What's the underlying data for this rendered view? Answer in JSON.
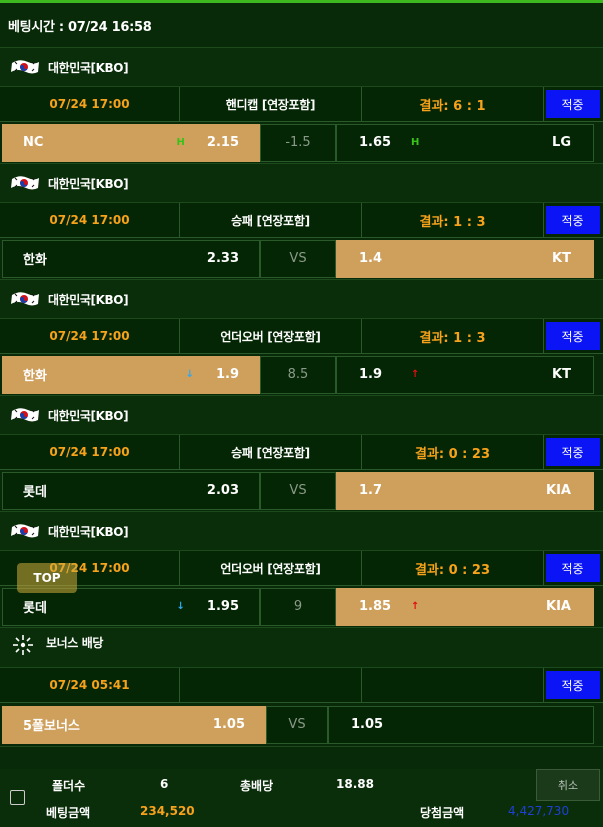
{
  "header": {
    "betting_time": "베팅시간 : 07/24 16:58"
  },
  "games": [
    {
      "league": "대한민국[KBO]",
      "time": "07/24 17:00",
      "bet_type": "핸디캡 [연장포함]",
      "result": "결과: 6 : 1",
      "status": "적중",
      "home": "NC",
      "home_mark": "H",
      "home_odds": "2.15",
      "mid": "-1.5",
      "away_odds": "1.65",
      "away_mark": "H",
      "away": "LG",
      "selected": "home"
    },
    {
      "league": "대한민국[KBO]",
      "time": "07/24 17:00",
      "bet_type": "승패 [연장포함]",
      "result": "결과: 1 : 3",
      "status": "적중",
      "home": "한화",
      "home_mark": "",
      "home_odds": "2.33",
      "mid": "VS",
      "away_odds": "1.4",
      "away_mark": "",
      "away": "KT",
      "selected": "away"
    },
    {
      "league": "대한민국[KBO]",
      "time": "07/24 17:00",
      "bet_type": "언더오버 [연장포함]",
      "result": "결과: 1 : 3",
      "status": "적중",
      "home": "한화",
      "home_mark": "↓",
      "home_odds": "1.9",
      "mid": "8.5",
      "away_odds": "1.9",
      "away_mark": "↑",
      "away": "KT",
      "selected": "home"
    },
    {
      "league": "대한민국[KBO]",
      "time": "07/24 17:00",
      "bet_type": "승패 [연장포함]",
      "result": "결과: 0 : 23",
      "status": "적중",
      "home": "롯데",
      "home_mark": "",
      "home_odds": "2.03",
      "mid": "VS",
      "away_odds": "1.7",
      "away_mark": "",
      "away": "KIA",
      "selected": "away"
    },
    {
      "league": "대한민국[KBO]",
      "time": "07/24 17:00",
      "bet_type": "언더오버 [연장포함]",
      "result": "결과: 0 : 23",
      "status": "적중",
      "home": "롯데",
      "home_mark": "↓",
      "home_odds": "1.95",
      "mid": "9",
      "away_odds": "1.85",
      "away_mark": "↑",
      "away": "KIA",
      "selected": "away"
    }
  ],
  "bonus": {
    "league": "보너스 배당",
    "time": "07/24 05:41",
    "status": "적중",
    "home": "5폴보너스",
    "home_odds": "1.05",
    "mid": "VS",
    "away_odds": "1.05"
  },
  "top_button": "TOP",
  "footer": {
    "fold_label": "폴더수",
    "fold_value": "6",
    "total_odds_label": "총배당",
    "total_odds_value": "18.88",
    "cancel_label": "취소",
    "bet_amount_label": "베팅금액",
    "bet_amount_value": "234,520",
    "win_amount_label": "당첨금액",
    "win_amount_value": "4,427,730"
  },
  "colors": {
    "accent_orange": "#f7a21b",
    "selected_cell": "#cf9f5c",
    "status_blue": "#0a14f5",
    "top_bar": "#3db81e"
  }
}
